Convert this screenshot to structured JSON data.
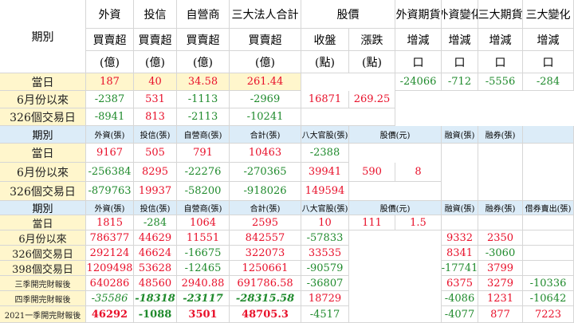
{
  "sec1": {
    "head": {
      "period": "期別",
      "foreign": "外資",
      "trust": "投信",
      "dealer": "自營商",
      "total3": "三大法人合計",
      "buysell": "買賣超",
      "unit": "(億)",
      "price": "股價",
      "close": "收盤",
      "close_unit": "(點)",
      "change": "漲跌",
      "change_unit": "(點)",
      "fut_pos": "外資期貨",
      "fut_chg": "外資變化",
      "big3_fut": "三大期貨",
      "big3_chg": "三大變化",
      "incdec": "增減",
      "box": "口"
    },
    "rows": [
      {
        "label": "當日",
        "v": [
          "187",
          "40",
          "34.58",
          "261.44"
        ],
        "fut": [
          "-24066",
          "-712",
          "-5556",
          "-284"
        ]
      },
      {
        "label": "6月份以來",
        "v": [
          "-2387",
          "531",
          "-1113",
          "-2969"
        ]
      },
      {
        "label": "326個交易日",
        "v": [
          "-8941",
          "813",
          "-2113",
          "-10241"
        ]
      }
    ],
    "close_val": "16871",
    "change_val": "269.25"
  },
  "sec2": {
    "head": {
      "period": "期別",
      "foreign": "外資(張)",
      "trust": "投信(張)",
      "dealer": "自營商(張)",
      "total": "合計(張)",
      "bank8": "八大官股(張)",
      "price": "股價(元)",
      "margin": "融資(張)",
      "short": "融券(張)"
    },
    "rows": [
      {
        "label": "當日",
        "v": [
          "9167",
          "505",
          "791",
          "10463"
        ],
        "bank8": "-2388"
      },
      {
        "label": "6月份以來",
        "v": [
          "-256384",
          "8295",
          "-22276",
          "-270365"
        ],
        "bank8": "39941"
      },
      {
        "label": "326個交易日",
        "v": [
          "-879763",
          "19937",
          "-58200",
          "-918026"
        ],
        "bank8": "149594"
      }
    ],
    "price_val": "590",
    "price_chg": "8"
  },
  "sec3": {
    "head": {
      "period": "期別",
      "foreign": "外資(張)",
      "trust": "投信(張)",
      "dealer": "自營商(張)",
      "total": "合計(張)",
      "bank8": "八大官股(張)",
      "price": "股價(元)",
      "margin": "融資(張)",
      "short": "融券(張)",
      "lend": "借券賣出(張)"
    },
    "rows": [
      {
        "label": "當日",
        "v": [
          "1815",
          "-284",
          "1064",
          "2595"
        ],
        "bank8": "10",
        "margin": "",
        "short": "",
        "lend": ""
      },
      {
        "label": "6月份以來",
        "v": [
          "786377",
          "44629",
          "11551",
          "842557"
        ],
        "bank8": "-57833",
        "margin": "9332",
        "short": "2350",
        "lend": ""
      },
      {
        "label": "326個交易日",
        "v": [
          "292124",
          "46624",
          "-16675",
          "322073"
        ],
        "bank8": "33535",
        "margin": "8341",
        "short": "-3060",
        "lend": ""
      },
      {
        "label": "398個交易日",
        "v": [
          "1209498",
          "53628",
          "-12465",
          "1250661"
        ],
        "bank8": "-90579",
        "margin": "-17741",
        "short": "3799",
        "lend": ""
      },
      {
        "label": "三季開完財報後",
        "v": [
          "640286",
          "48560",
          "2940.88",
          "691786.58"
        ],
        "bank8": "-36807",
        "margin": "6375",
        "short": "3279",
        "lend": "-10336"
      },
      {
        "label": "四季開完財報後",
        "v": [
          "-35586",
          "-18318",
          "-23117",
          "-28315.58"
        ],
        "bank8": "18729",
        "margin": "-4086",
        "short": "1231",
        "lend": "-10642"
      },
      {
        "label": "2021一季開完財報後",
        "v": [
          "46292",
          "-1088",
          "3501",
          "48705.3"
        ],
        "bank8": "-4517",
        "margin": "-4077",
        "short": "877",
        "lend": "7223"
      }
    ],
    "price_val": "111",
    "price_chg": "1.5"
  }
}
